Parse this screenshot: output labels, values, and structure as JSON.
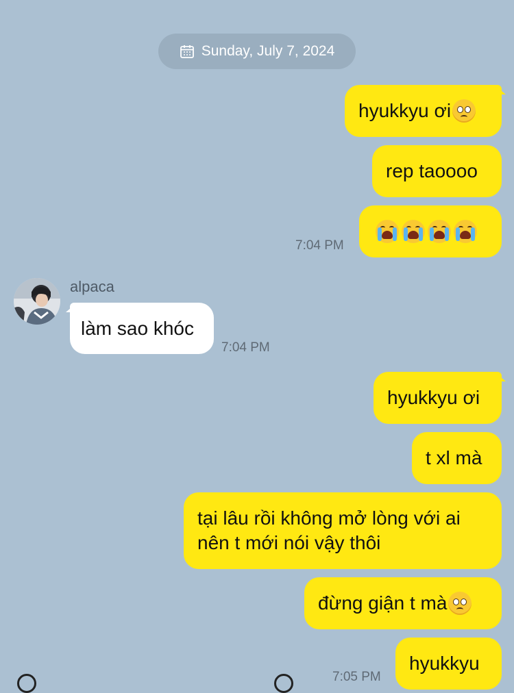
{
  "date_divider": {
    "label": "Sunday, July 7, 2024",
    "icon": "calendar-icon"
  },
  "messages": [
    {
      "side": "out",
      "text": "hyukkyu ơi",
      "emoji": "pleading-face"
    },
    {
      "side": "out",
      "text": "rep taoooo"
    },
    {
      "side": "out",
      "emoji": "loudly-crying-face-x4",
      "time": "7:04 PM"
    },
    {
      "side": "in",
      "sender": "alpaca",
      "text": "làm sao khóc",
      "time": "7:04 PM"
    },
    {
      "side": "out",
      "text": "hyukkyu ơi"
    },
    {
      "side": "out",
      "text": "t xl mà"
    },
    {
      "side": "out",
      "text": "tại lâu rồi không mở lòng với ai nên t mới nói vậy thôi"
    },
    {
      "side": "out",
      "text": "đừng giận t mà",
      "emoji": "pleading-face"
    },
    {
      "side": "out",
      "text": "hyukkyu",
      "time": "7:05 PM"
    }
  ],
  "colors": {
    "background": "#abc0d2",
    "outgoing": "#ffe812",
    "incoming": "#ffffff"
  }
}
